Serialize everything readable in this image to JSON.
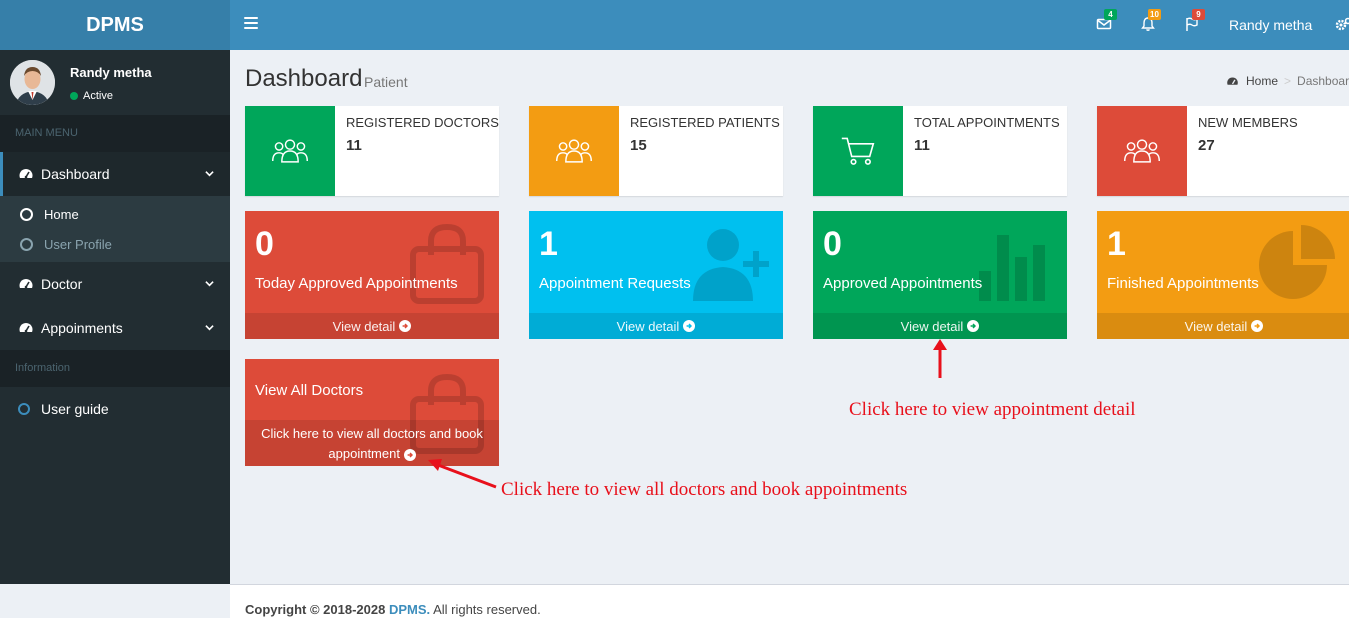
{
  "header": {
    "logo": "DPMS",
    "user_name": "Randy metha",
    "badges": {
      "messages": "4",
      "notifications": "10",
      "tasks": "9"
    },
    "colors": {
      "logo_bg": "#367fa9",
      "navbar_bg": "#3c8dbc"
    }
  },
  "sidebar": {
    "user": {
      "name": "Randy metha",
      "status": "Active"
    },
    "main_menu_header": "MAIN MENU",
    "items": {
      "dashboard": "Dashboard",
      "home": "Home",
      "user_profile": "User Profile",
      "doctor": "Doctor",
      "appointments": "Appoinments"
    },
    "info_header": "Information",
    "user_guide": "User guide"
  },
  "page": {
    "title": "Dashboard",
    "subtitle": "Patient",
    "breadcrumb": {
      "home": "Home",
      "current": "Dashboard"
    }
  },
  "info_boxes": [
    {
      "label": "REGISTERED DOCTORS",
      "value": "11",
      "color": "#00a65a",
      "icon": "users-icon"
    },
    {
      "label": "REGISTERED PATIENTS",
      "value": "15",
      "color": "#f39c12",
      "icon": "users-icon"
    },
    {
      "label": "TOTAL APPOINTMENTS",
      "value": "11",
      "color": "#00a65a",
      "icon": "cart-icon"
    },
    {
      "label": "NEW MEMBERS",
      "value": "27",
      "color": "#dd4b39",
      "icon": "users-icon"
    }
  ],
  "small_boxes": [
    {
      "value": "0",
      "label": "Today Approved Appointments",
      "footer": "View detail",
      "color": "#dd4b39",
      "icon": "bag-icon"
    },
    {
      "value": "1",
      "label": "Appointment Requests",
      "footer": "View detail",
      "color": "#00c0ef",
      "icon": "user-plus-icon"
    },
    {
      "value": "0",
      "label": "Approved Appointments",
      "footer": "View detail",
      "color": "#00a65a",
      "icon": "bar-chart-icon"
    },
    {
      "value": "1",
      "label": "Finished Appointments",
      "footer": "View detail",
      "color": "#f39c12",
      "icon": "pie-chart-icon"
    }
  ],
  "doctors_box": {
    "title": "View All Doctors",
    "footer": "Click here to view all doctors and book appointment",
    "color": "#dd4b39"
  },
  "annotations": {
    "appointment_detail": "Click here to view appointment detail",
    "doctors": "Click here to view all doctors and book appointments",
    "color": "#e8101b"
  },
  "footer": {
    "copyright": "Copyright © 2018-2028",
    "brand": "DPMS.",
    "rights": "All rights reserved."
  }
}
